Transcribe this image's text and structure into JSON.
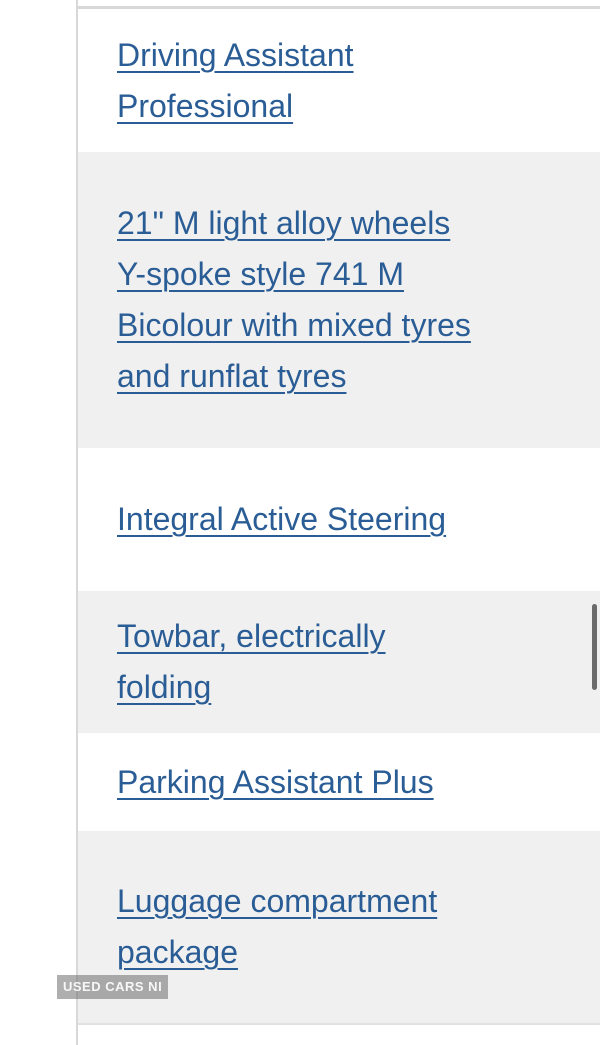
{
  "features": [
    {
      "label": "Driving Assistant Professional"
    },
    {
      "label": "21\" M light alloy wheels Y-spoke style 741 M Bicolour with mixed tyres and runflat tyres"
    },
    {
      "label": "Integral Active Steering"
    },
    {
      "label": "Towbar, electrically folding"
    },
    {
      "label": "Parking Assistant Plus"
    },
    {
      "label": "Luggage compartment package"
    }
  ],
  "watermark": {
    "text": "USED CARS NI"
  },
  "colors": {
    "link": "#2a5d95",
    "row_alt_bg": "#f0f0f0",
    "row_bg": "#ffffff"
  }
}
